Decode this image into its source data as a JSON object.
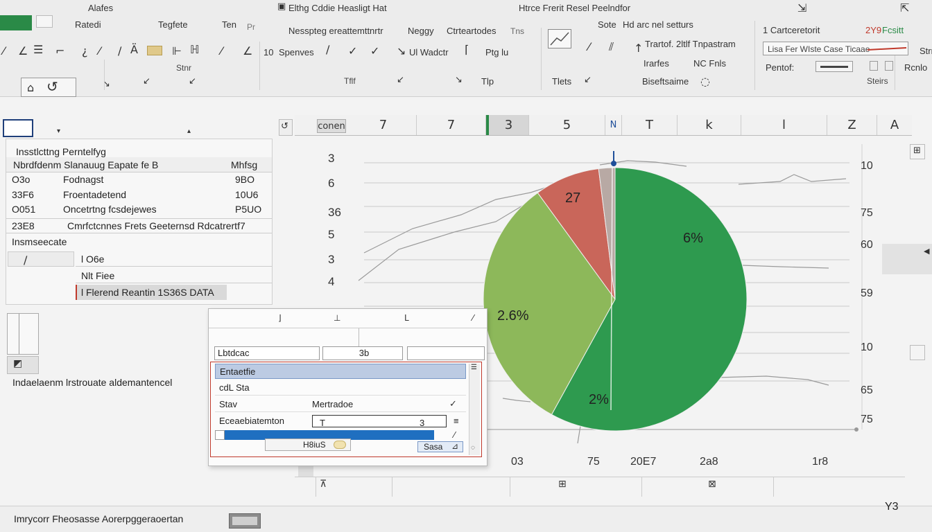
{
  "ribbon": {
    "row1": {
      "tab_left": "Alafes",
      "title": "Elthg Cddie Heasligt Hat",
      "title_right": "Htrce Frerit Resel Peelndfor"
    },
    "row2": {
      "group1": "Ratedi",
      "group2": "Tegfete",
      "group3": "Ten",
      "group3b": "Pr",
      "group4": "Nesspteg ereattemttnrtr",
      "group5": "Neggy",
      "group6": "Ctrteartodes",
      "group7": "Tns",
      "group8": "Sote",
      "group8b": "Hd arc nel setturs",
      "group9": "1 Cartceretorit",
      "value_red": "2Y9",
      "value_green": "Fcsitt"
    },
    "row3": {
      "font_size": "10",
      "font_name": "Spenves",
      "align_label": "Ul Wadctr",
      "indent_label": "Ptg lu",
      "style_label": "Trartof. 2ltlf Tnpastram",
      "pct_box": "Lisa Fer WIste Case Ticaae",
      "sort_label": "Strr"
    },
    "row4": {
      "interface": "Irarfes",
      "nc": "NC Fnls",
      "paste": "Pentof:",
      "refresh": "Rcnlo"
    },
    "row5": {
      "tile": "Tlp",
      "ties": "Tlets",
      "bisefaime": "Biseftsaime",
      "steirs": "Steirs"
    }
  },
  "column_header": {
    "name_box": "conen",
    "cols": [
      "7",
      "7",
      "3",
      "5",
      "N",
      "T",
      "k",
      "l",
      "Z",
      "A"
    ]
  },
  "left_pane": {
    "title": "Insstlcttng Perntelfyg",
    "header_left": "Nbrdfdenm Slanauug Eapate fe B",
    "header_right": "Mhfsg",
    "rows": [
      {
        "a": "O3o",
        "b": "Fodnagst",
        "c": "9BO"
      },
      {
        "a": "33F6",
        "b": "Froentadetend",
        "c": "10U6"
      },
      {
        "a": "O051",
        "b": "Oncetrtng fcsdejewes",
        "c": "P5UO"
      },
      {
        "a": "23E8",
        "b": "Cmrfctcnnes Frets Geeternsd Rdcatrertf7",
        "c": ""
      }
    ],
    "section": "Insmseecate",
    "sub_rows": [
      "l O6e",
      "Nlt Fiee",
      "l Flerend Reantin 1S36S DATA"
    ],
    "caption": "Indaelaenm lrstrouate aldemantencel"
  },
  "chart": {
    "y_left_ticks": [
      "3",
      "6",
      "36",
      "5",
      "3",
      "4"
    ],
    "y_right_ticks": [
      "10",
      "75",
      "60",
      "59",
      "10",
      "65",
      "75"
    ],
    "x_ticks": [
      "03",
      "75",
      "20E7",
      "2a8",
      "1r8"
    ]
  },
  "chart_data": {
    "type": "pie",
    "slices": [
      {
        "label": "6%",
        "value": 58,
        "color": "#2e9a4f"
      },
      {
        "label": "2.6%",
        "value": 32,
        "color": "#8db85a"
      },
      {
        "label": "27",
        "value": 8,
        "color": "#c9665a"
      },
      {
        "label": "",
        "value": 2,
        "color": "#b8a9a4"
      }
    ],
    "bottom_label": "2%"
  },
  "dialog": {
    "field_left": "Lbtdcac",
    "field_mid": "3b",
    "list_header": "Entaetfie",
    "items": [
      {
        "a": "cdL Sta",
        "b": ""
      },
      {
        "a": "Stav",
        "b": "Mertradoe"
      }
    ],
    "editor_label": "Eceaebiatemton",
    "editor_value": "T",
    "editor_num": "3",
    "ok_label": "H8iuS",
    "cancel_label": "Sasa"
  },
  "status": {
    "left_text": "Imrycorr Fheosasse Aorerpggeraoertan",
    "right_text": "Y3"
  }
}
